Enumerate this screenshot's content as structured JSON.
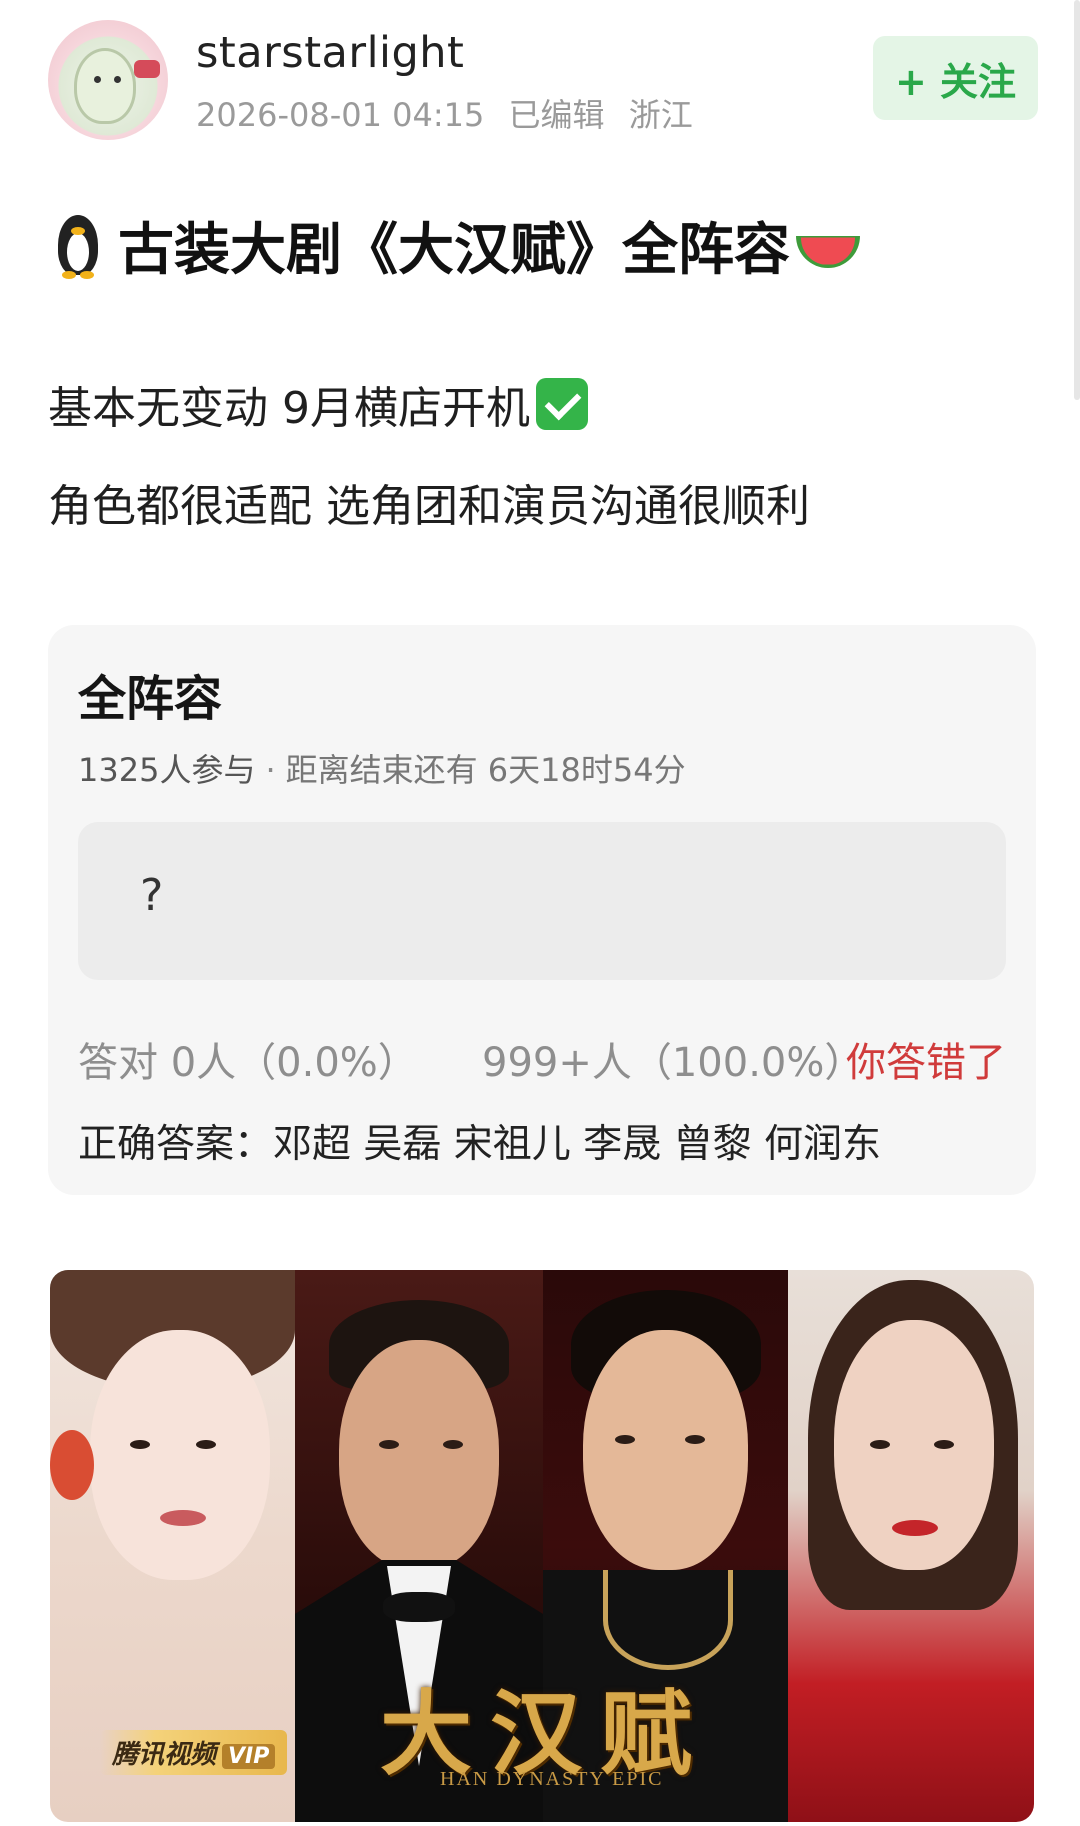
{
  "post": {
    "username": "starstarlight",
    "date": "2026-08-01 04:15",
    "edited": "已编辑",
    "location": "浙江",
    "follow_label": "+ 关注",
    "title": "古装大剧《大汉赋》全阵容",
    "line1": "基本无变动 9月横店开机",
    "line2": "角色都很适配 选角团和演员沟通很顺利"
  },
  "quiz": {
    "title": "全阵容",
    "participants": "1325人参与",
    "separator": "·",
    "remaining": "距离结束还有 6天18时54分",
    "option_text": "?",
    "correct_stat": "答对  0人（0.0%）",
    "answered_stat": "999+人（100.0%）",
    "result": "你答错了",
    "answer": "正确答案：邓超 吴磊 宋祖儿 李晟 曾黎 何润东"
  },
  "poster": {
    "logo": "大汉赋",
    "subtitle": "HAN DYNASTY EPIC",
    "platform": "腾讯视频",
    "vip": "VIP"
  },
  "icons": {
    "title_prefix": "penguin-icon",
    "title_suffix": "watermelon-icon",
    "check": "check-mark-icon"
  },
  "colors": {
    "follow_bg": "#e4f5e6",
    "follow_text": "#2aa84a",
    "wrong_text": "#d03b3b",
    "quiz_bg": "#f6f6f6"
  }
}
